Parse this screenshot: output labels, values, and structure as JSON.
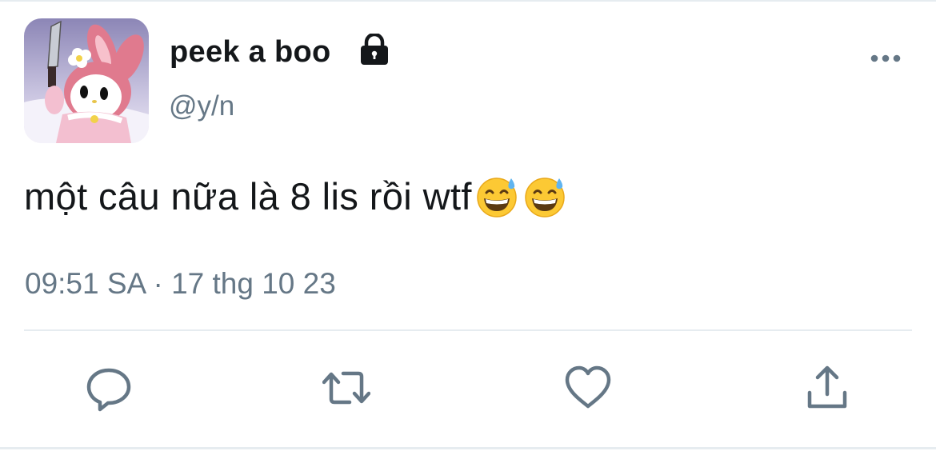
{
  "tweet": {
    "display_name": "peek a boo",
    "handle": "@y/n",
    "text": "một câu nữa là 8 lis rồi wtf",
    "emojis": [
      "grinning-face-with-sweat",
      "grinning-face-with-sweat"
    ],
    "timestamp": "09:51 SA · 17 thg 10 23",
    "protected_icon": "lock-icon"
  },
  "actions": [
    {
      "name": "reply",
      "icon": "reply-icon"
    },
    {
      "name": "retweet",
      "icon": "retweet-icon"
    },
    {
      "name": "like",
      "icon": "heart-icon"
    },
    {
      "name": "share",
      "icon": "share-icon"
    }
  ],
  "colors": {
    "text": "#14171a",
    "secondary": "#657786",
    "divider": "#e6ecf0",
    "icon": "#657786"
  }
}
